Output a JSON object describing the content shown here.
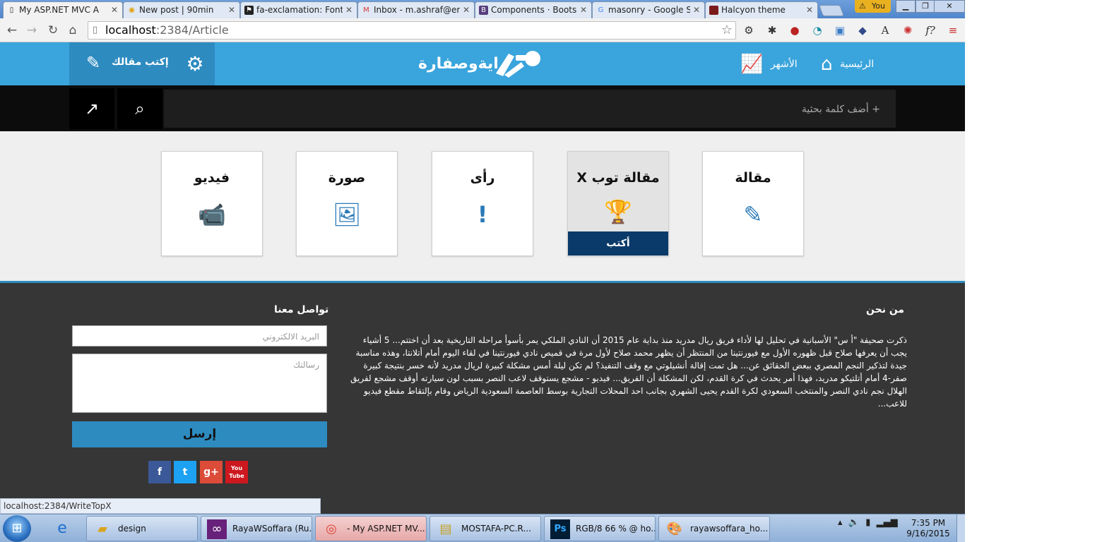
{
  "browser": {
    "tabs": [
      {
        "label": "My ASP.NET MVC A",
        "favicon": "page-icon",
        "active": true
      },
      {
        "label": "New post | 90min",
        "favicon": "90min-icon",
        "active": false
      },
      {
        "label": "fa-exclamation: Font",
        "favicon": "flag-icon",
        "active": false
      },
      {
        "label": "Inbox - m.ashraf@er",
        "favicon": "gmail-icon",
        "active": false
      },
      {
        "label": "Components · Boots",
        "favicon": "bootstrap-icon",
        "active": false
      },
      {
        "label": "masonry - Google Se",
        "favicon": "google-icon",
        "active": false
      },
      {
        "label": "Halcyon theme",
        "favicon": "halcyon-icon",
        "active": false
      }
    ],
    "user_badge": "You",
    "address": {
      "host": "localhost",
      "path": ":2384/Article"
    },
    "status_url": "localhost:2384/WriteTopX"
  },
  "site": {
    "brand": "رايةوصفارة",
    "nav": {
      "home": "الرئيسية",
      "popular": "الأشهر"
    },
    "write_label": "إكتب مقالك",
    "search_placeholder": "+ أضف كلمة بحثية"
  },
  "cards": [
    {
      "title": "مقالة",
      "icon": "edit-icon"
    },
    {
      "title": "مقالة توب X",
      "icon": "trophy-icon",
      "cta": "أكتب",
      "featured": true
    },
    {
      "title": "رأى",
      "icon": "exclamation-icon"
    },
    {
      "title": "صورة",
      "icon": "image-icon"
    },
    {
      "title": "فيديو",
      "icon": "video-camera-icon"
    }
  ],
  "footer": {
    "about_title": "من نحن",
    "about_text": "ذكرت صحيفة \"أ س\" الأسبانية في تحليل لها لأداء فريق ريال مدريد منذ بداية عام 2015 أن النادي الملكي يمر بأسوأ مراحله التاريخية بعد أن اختتم... 5 أشياء يجب أن يعرفها صلاح قبل ظهوره الأول مع فيورنتينا من المنتظر أن يظهر محمد صلاح لأول مرة في قميص نادي فيورنتينا في لقاء اليوم أمام أتلانتا، وهذه مناسبة جيدة لتذكير النجم المصري ببعض الحقائق عن... هل تمت إقالة أنشيلوتي مع وقف التنفيذ؟ لم تكن ليلة أمس مشكلة كبيرة لريال مدريد لأنه خسر بنتيجة كبيرة صفر-4 أمام أتلتيكو مدريد، فهذا أمر يحدث في كرة القدم، لكن المشكلة أن الفريق... فيديو - مشجع يستوقف لاعب النصر بسبب لون سيارته أوقف مشجع لفريق الهلال نجم نادي النصر والمنتخب السعودي لكرة القدم يحيى الشهري بجانب احد المحلات التجارية بوسط العاصمة السعودية الرياض وقام بإلتقاط مقطع فيديو للاعب...",
    "contact_title": "تواصل معنا",
    "email_placeholder": "البريد الالكتروني",
    "message_placeholder": "رسالتك",
    "send_label": "إرسل",
    "social": [
      {
        "name": "facebook-icon",
        "glyph": "f",
        "color": "#3b5998"
      },
      {
        "name": "twitter-icon",
        "glyph": "t",
        "color": "#1da1f2"
      },
      {
        "name": "google-plus-icon",
        "glyph": "g+",
        "color": "#dd4b39"
      },
      {
        "name": "youtube-icon",
        "glyph": "You Tube",
        "color": "#cc181e"
      }
    ]
  },
  "taskbar": {
    "buttons": [
      {
        "label": "design",
        "icon": "folder-icon"
      },
      {
        "label": "RayaWSoffara (Ru...",
        "icon": "visual-studio-icon"
      },
      {
        "label": "- My ASP.NET MV...",
        "icon": "chrome-icon",
        "active": true
      },
      {
        "label": "MOSTAFA-PC.R...",
        "icon": "sql-server-icon"
      },
      {
        "label": "RGB/8 66 % @ ho...",
        "icon": "photoshop-icon"
      },
      {
        "label": "rayawsoffara_ho...",
        "icon": "paint-icon"
      }
    ],
    "time": "7:35 PM",
    "date": "9/16/2015"
  },
  "colors": {
    "primary": "#3aa4dc",
    "primary_dark": "#2e8bc0",
    "navy": "#0a3a6a",
    "footer": "#363636",
    "icon_blue": "#2a7ab8"
  }
}
